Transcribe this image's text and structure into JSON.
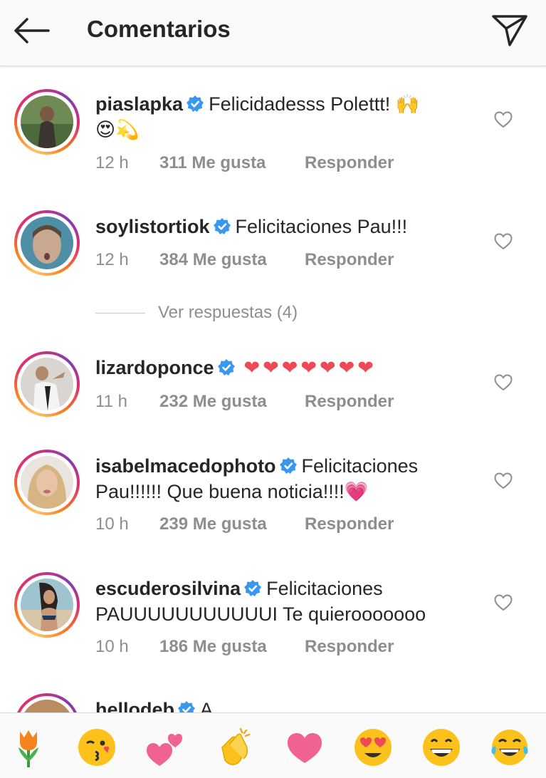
{
  "header": {
    "title": "Comentarios"
  },
  "comments": [
    {
      "username": "piaslapka",
      "text": "Felicidadesss Polettt! 🙌",
      "text2": "😍💫",
      "time": "12 h",
      "likes": "311 Me gusta",
      "reply": "Responder"
    },
    {
      "username": "soylistortiok",
      "text": "Felicitaciones Pau!!!",
      "time": "12 h",
      "likes": "384 Me gusta",
      "reply": "Responder"
    },
    {
      "username": "lizardoponce",
      "text": "❤❤❤❤❤❤❤",
      "time": "11 h",
      "likes": "232 Me gusta",
      "reply": "Responder"
    },
    {
      "username": "isabelmacedophoto",
      "text": "Felicitaciones",
      "text2": "Pau!!!!!! Que buena noticia!!!!💗",
      "time": "10 h",
      "likes": "239 Me gusta",
      "reply": "Responder"
    },
    {
      "username": "escuderosilvina",
      "text": "Felicitaciones",
      "text2": "PAUUUUUUUUUUUI Te quierooooooo",
      "time": "10 h",
      "likes": "186 Me gusta",
      "reply": "Responder"
    },
    {
      "username": "hellodeb",
      "text": "A"
    }
  ],
  "view_replies": "Ver respuestas (4)",
  "emoji_bar": [
    "tulip",
    "kissing-wink",
    "two-hearts",
    "clapping-hands",
    "heart",
    "heart-eyes",
    "grinning",
    "tears-of-joy"
  ],
  "colors": {
    "verified": "#3897f0",
    "heart_red": "#ed4956",
    "muted": "#8e8e8e",
    "text": "#262626"
  }
}
